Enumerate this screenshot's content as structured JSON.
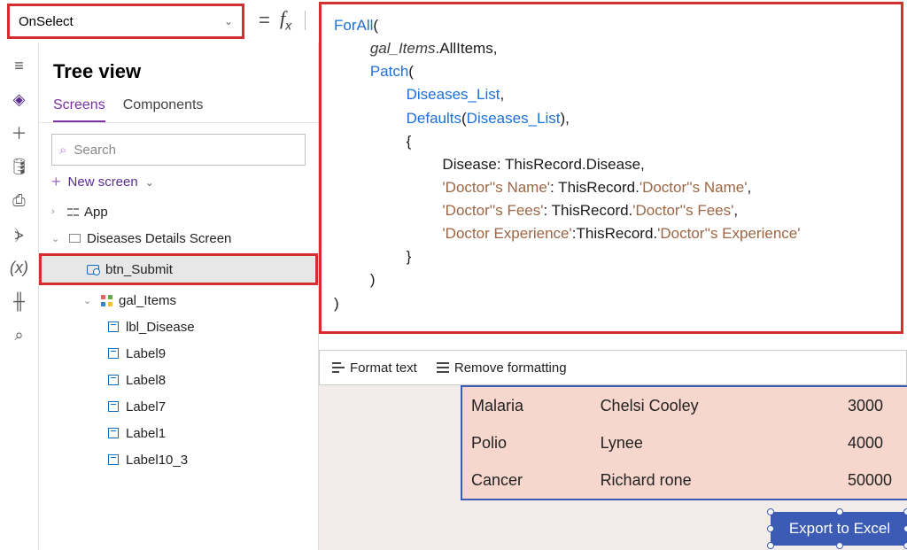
{
  "property_selector": "OnSelect",
  "tree": {
    "title": "Tree view",
    "tabs": {
      "screens": "Screens",
      "components": "Components"
    },
    "search_placeholder": "Search",
    "new_screen": "New screen",
    "nodes": {
      "app": "App",
      "screen1": "Diseases Details Screen",
      "btn": "btn_Submit",
      "gal": "gal_Items",
      "lbl_disease": "lbl_Disease",
      "label9": "Label9",
      "label8": "Label8",
      "label7": "Label7",
      "label1": "Label1",
      "label10_3": "Label10_3"
    }
  },
  "formula": {
    "l1a": "ForAll",
    "l1b": "(",
    "l2a": "gal_Items",
    "l2b": ".AllItems,",
    "l3a": "Patch",
    "l3b": "(",
    "l4a": "Diseases_List",
    "l4b": ",",
    "l5a": "Defaults",
    "l5b": "(",
    "l5c": "Diseases_List",
    "l5d": "),",
    "l6": "{",
    "l7": "Disease: ThisRecord.Disease,",
    "l8a": "'Doctor'",
    "l8b": "'s Name'",
    "l8c": ": ThisRecord.",
    "l8d": "'Doctor'",
    "l8e": "'s Name'",
    "l8f": ",",
    "l9a": "'Doctor'",
    "l9b": "'s Fees'",
    "l9c": ": ThisRecord.",
    "l9d": "'Doctor'",
    "l9e": "'s Fees'",
    "l9f": ",",
    "l10a": "'Doctor Experience'",
    "l10b": ":ThisRecord.",
    "l10c": "'Doctor'",
    "l10d": "'s Experience'",
    "l11": "}",
    "l12": ")",
    "l13": ")"
  },
  "format_bar": {
    "format": "Format text",
    "remove": "Remove formatting"
  },
  "gallery": {
    "rows": [
      {
        "disease": "Malaria",
        "doctor": "Chelsi Cooley",
        "fee": "3000"
      },
      {
        "disease": "Polio",
        "doctor": "Lynee",
        "fee": "4000"
      },
      {
        "disease": "Cancer",
        "doctor": "Richard rone",
        "fee": "50000"
      }
    ]
  },
  "export_label": "Export to Excel"
}
